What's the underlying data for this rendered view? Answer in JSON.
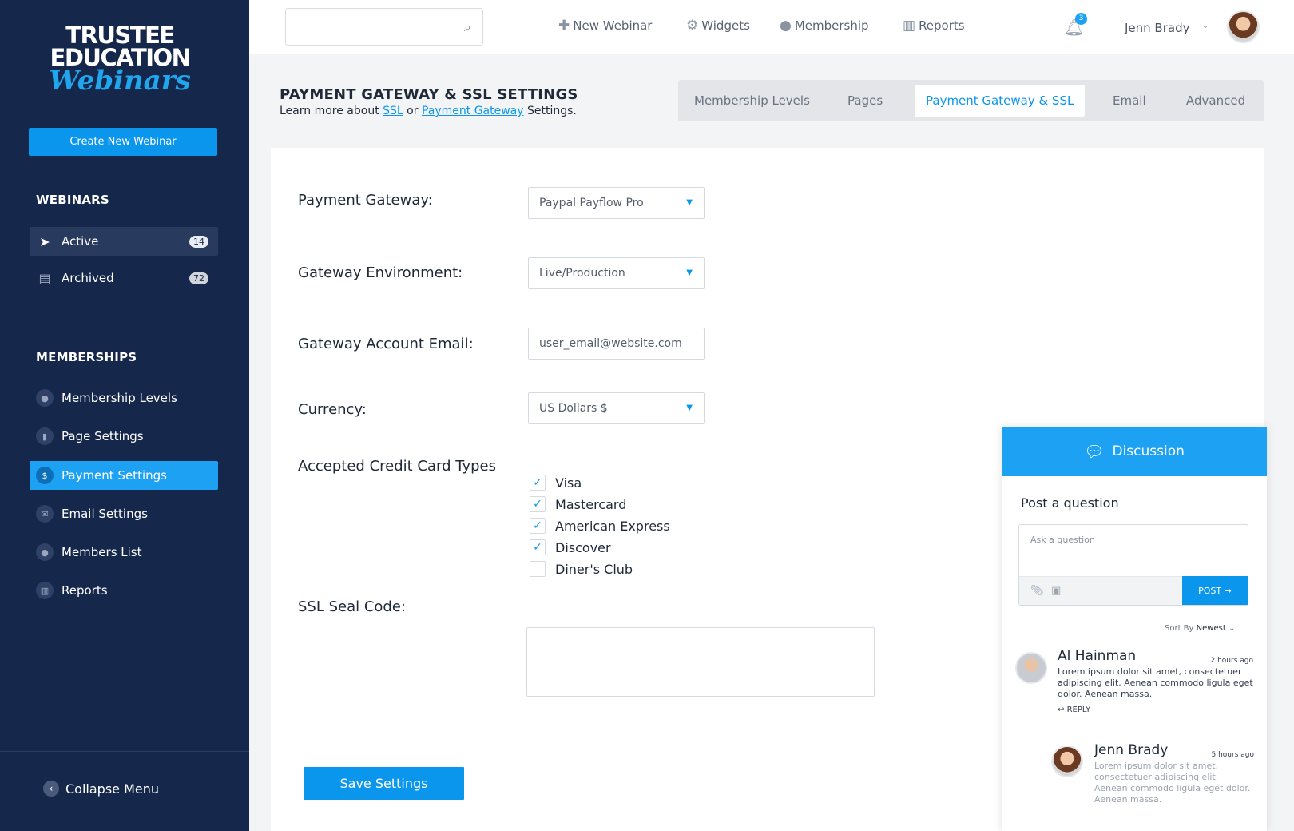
{
  "sidebar": {
    "logo": {
      "line1": "TRUSTEE",
      "line2": "EDUCATION",
      "line3": "Webinars"
    },
    "create_button": "Create New Webinar",
    "webinars_title": "WEBINARS",
    "webinar_items": [
      {
        "label": "Active",
        "count": "14",
        "icon": "paper-plane-icon"
      },
      {
        "label": "Archived",
        "count": "72",
        "icon": "archive-box-icon"
      }
    ],
    "memberships_title": "MEMBERSHIPS",
    "membership_items": [
      {
        "label": "Membership Levels",
        "icon": "users-icon"
      },
      {
        "label": "Page Settings",
        "icon": "page-icon"
      },
      {
        "label": "Payment Settings",
        "icon": "dollar-icon"
      },
      {
        "label": "Email Settings",
        "icon": "mail-icon"
      },
      {
        "label": "Members List",
        "icon": "users-icon"
      },
      {
        "label": "Reports",
        "icon": "bar-chart-icon"
      }
    ],
    "collapse_label": "Collapse Menu"
  },
  "topbar": {
    "search_placeholder": "",
    "nav": [
      {
        "label": "New Webinar",
        "icon": "plus-icon"
      },
      {
        "label": "Widgets",
        "icon": "gear-icon"
      },
      {
        "label": "Membership",
        "icon": "users-icon"
      },
      {
        "label": "Reports",
        "icon": "bar-chart-icon"
      }
    ],
    "notification_count": "3",
    "user_name": "Jenn Brady"
  },
  "page": {
    "title": "PAYMENT GATEWAY & SSL SETTINGS",
    "sub_prefix": "Learn more about",
    "sub_link1": "SSL",
    "sub_mid": "or",
    "sub_link2": "Payment Gateway",
    "sub_suffix": "Settings."
  },
  "tabs": [
    "Membership Levels",
    "Pages",
    "Payment Gateway & SSL",
    "Email",
    "Advanced"
  ],
  "form": {
    "gateway_label": "Payment Gateway:",
    "gateway_value": "Paypal Payflow Pro",
    "environment_label": "Gateway Environment:",
    "environment_value": "Live/Production",
    "email_label": "Gateway Account Email:",
    "email_value": "user_email@website.com",
    "currency_label": "Currency:",
    "currency_value": "US Dollars $",
    "cards_label": "Accepted Credit Card Types",
    "cards": [
      {
        "label": "Visa",
        "checked": true
      },
      {
        "label": "Mastercard",
        "checked": true
      },
      {
        "label": "American Express",
        "checked": true
      },
      {
        "label": "Discover",
        "checked": true
      },
      {
        "label": "Diner's Club",
        "checked": false
      }
    ],
    "ssl_label": "SSL Seal Code:",
    "save_button": "Save Settings"
  },
  "discussion": {
    "title": "Discussion",
    "post_question": "Post a question",
    "ask_placeholder": "Ask a question",
    "post_button": "POST",
    "sort_label": "Sort By",
    "sort_value": "Newest",
    "comments": [
      {
        "name": "Al Hainman",
        "time": "2 hours ago",
        "text": "Lorem ipsum dolor sit amet, consectetuer adipiscing elit. Aenean commodo ligula eget dolor. Aenean massa.",
        "reply": "REPLY"
      },
      {
        "name": "Jenn Brady",
        "time": "5 hours ago",
        "text": "Lorem ipsum dolor sit amet, consectetuer adipiscing elit. Aenean commodo ligula eget dolor. Aenean massa."
      }
    ]
  },
  "colors": {
    "sidebar": "#15274b",
    "accent": "#0b96ee",
    "selected": "#1da1f2"
  }
}
